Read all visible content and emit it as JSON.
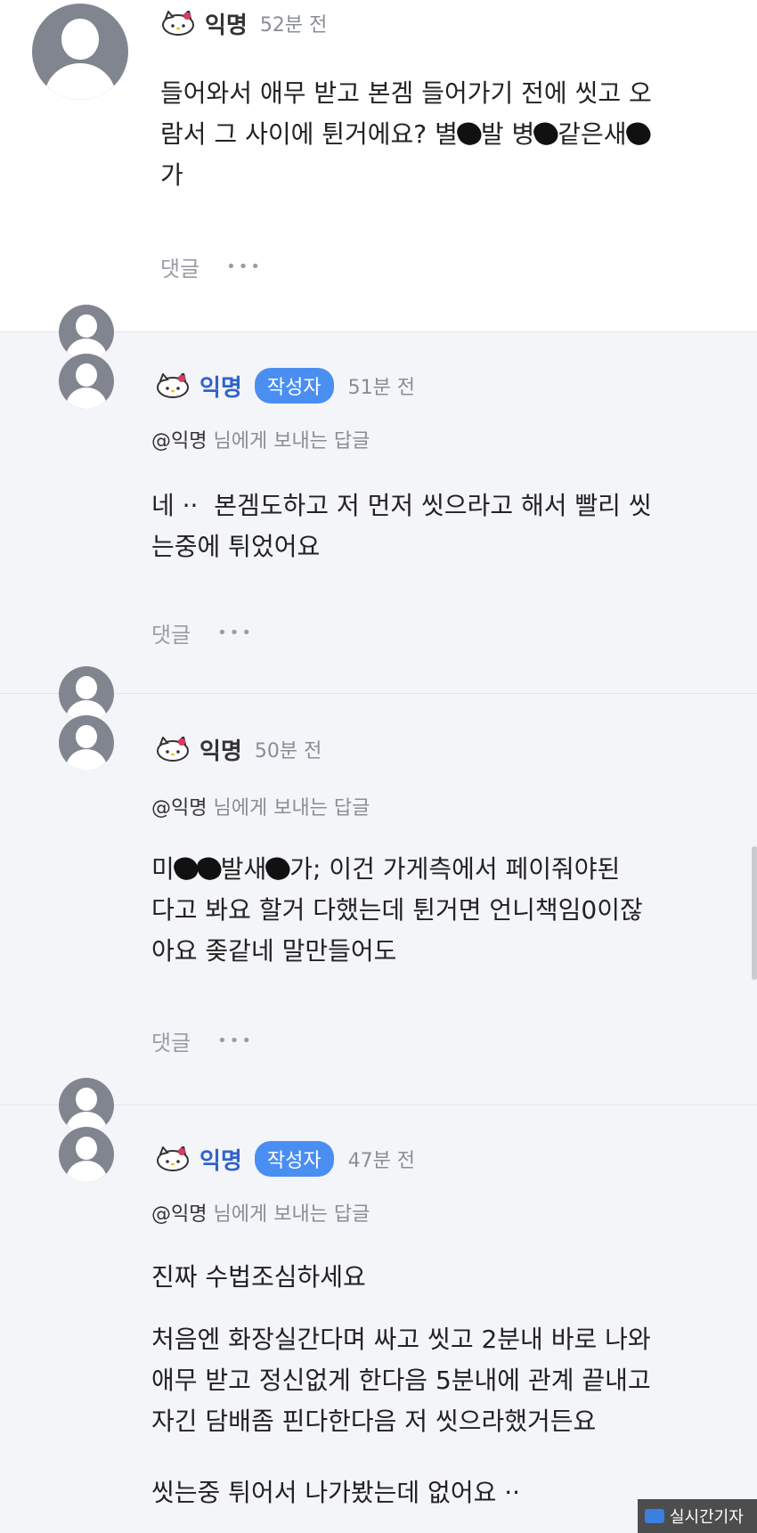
{
  "comments": [
    {
      "author": "익명",
      "time": "52분 전",
      "lines": [
        "들어와서 애무 받고 본겜 들어가기 전에 씻고 오",
        "람서 그 사이에 튄거에요? 별",
        "발 병",
        "같은새",
        "가"
      ],
      "reply_label": "댓글"
    },
    {
      "author": "익명",
      "badge": "작성자",
      "time": "51분 전",
      "reply_to": "@익명",
      "reply_to_suffix": "님에게 보내는 답글",
      "text": "네 ··  본겜도하고 저 먼저 씻으라고 해서 빨리 씻\n는중에 튀었어요",
      "reply_label": "댓글"
    },
    {
      "author": "익명",
      "time": "50분 전",
      "reply_to": "@익명",
      "reply_to_suffix": "님에게 보내는 답글",
      "text_parts": [
        "미",
        "발새",
        "가; 이건 가게측에서 페이줘야된\n다고 봐요 할거 다했는데 튄거면 언니책임0이잖\n아요 좆같네 말만들어도"
      ],
      "reply_label": "댓글"
    },
    {
      "author": "익명",
      "badge": "작성자",
      "time": "47분 전",
      "reply_to": "@익명",
      "reply_to_suffix": "님에게 보내는 답글",
      "paragraphs": [
        "진짜 수법조심하세요",
        "처음엔 화장실간다며 싸고 씻고 2분내 바로 나와\n애무 받고 정신없게 한다음 5분내에 관계 끝내고\n자긴 담배좀 핀다한다음 저 씻으라했거든요",
        "씻는중 튀어서 나가봤는데 없어요 ··"
      ]
    }
  ],
  "more_icon": "•••",
  "watermark": "실시간기자",
  "colors": {
    "reply_bg": "#f4f5f9",
    "badge": "#4a8ef2",
    "author_op": "#2f63c9",
    "avatar": "#80858f"
  }
}
